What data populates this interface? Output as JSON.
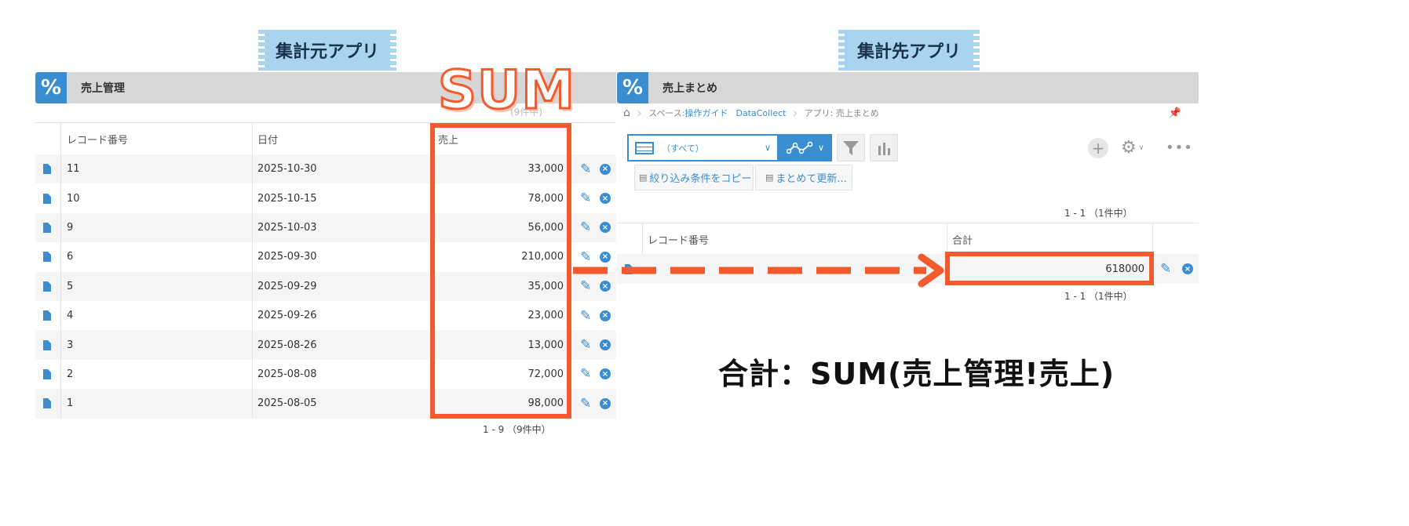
{
  "left": {
    "banner": "集計元アプリ",
    "app_icon": "%",
    "app_title": "売上管理",
    "columns": [
      "レコード番号",
      "日付",
      "売上"
    ],
    "records": [
      {
        "no": "11",
        "date": "2025-10-30",
        "sales": "33,000"
      },
      {
        "no": "10",
        "date": "2025-10-15",
        "sales": "78,000"
      },
      {
        "no": "9",
        "date": "2025-10-03",
        "sales": "56,000"
      },
      {
        "no": "6",
        "date": "2025-09-30",
        "sales": "210,000"
      },
      {
        "no": "5",
        "date": "2025-09-29",
        "sales": "35,000"
      },
      {
        "no": "4",
        "date": "2025-09-26",
        "sales": "23,000"
      },
      {
        "no": "3",
        "date": "2025-08-26",
        "sales": "13,000"
      },
      {
        "no": "2",
        "date": "2025-08-08",
        "sales": "72,000"
      },
      {
        "no": "1",
        "date": "2025-08-05",
        "sales": "98,000"
      }
    ],
    "pager_top": "(9件中)",
    "pager": "1 - 9 （9件中）"
  },
  "sum_label": "SUM",
  "right": {
    "banner": "集計先アプリ",
    "app_icon": "%",
    "app_title": "売上まとめ",
    "breadcrumb": {
      "space_prefix": "スペース: ",
      "space_link": "操作ガイド",
      "space_name": "DataCollect",
      "app": "アプリ: 売上まとめ"
    },
    "view_select": "（すべて）",
    "copy_filter": "絞り込み条件をコピー",
    "bulk_update": "まとめて更新...",
    "pager_top": "1 - 1 （1件中）",
    "columns": [
      "レコード番号",
      "合計"
    ],
    "record": {
      "total": "618000"
    },
    "pager_bottom": "1 - 1 （1件中）"
  },
  "formula": "合計：SUM(売上管理!売上)",
  "colors": {
    "accent": "#3a8ed0",
    "highlight": "#f35b2f",
    "banner": "#a9d3ee",
    "appbar": "#d5d7d8"
  }
}
